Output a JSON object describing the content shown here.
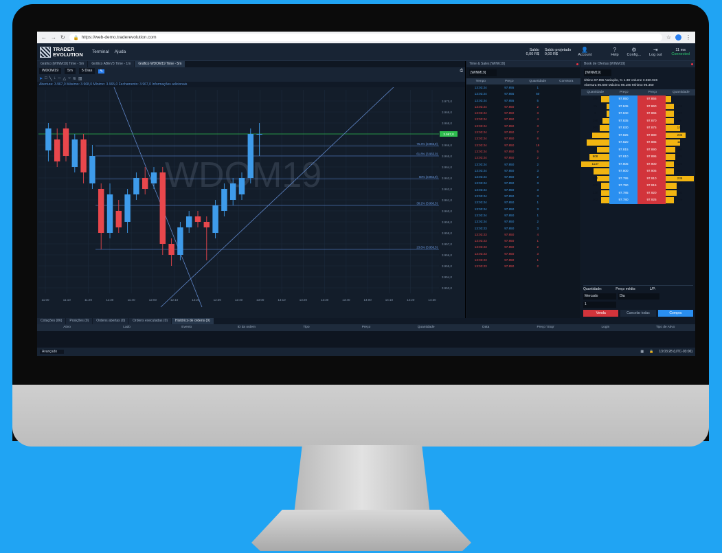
{
  "browser": {
    "url": "https://web-demo.traderevolution.com"
  },
  "app": {
    "logo_line1": "TRADER",
    "logo_line2": "EVOLUTION",
    "menu": [
      "Terminal",
      "Ajuda"
    ],
    "saldo_label": "Saldo",
    "saldo_value": "0,00 R$",
    "projetado_label": "Saldo projetado",
    "projetado_value": "0,00 R$",
    "account_label": "Account",
    "help_label": "Help",
    "config_label": "Config...",
    "logout_label": "Log out",
    "latency": "11 ms",
    "connection": "Connected"
  },
  "tabs": [
    "Gráfico [WINM19] Time - 5m",
    "Gráfico ABEV3 Time - 1m",
    "Gráfico WDOM19 Time - 5m"
  ],
  "chart_ctrl": {
    "symbol": "WDOM19",
    "timeframe": "5m",
    "period": "5 Dias"
  },
  "chart_ohlc": "Abertura: 3.967,0  Máximo: 3.968,0  Mínimo: 3.965,0  Fechamento: 3.967,0  Informações adicionais",
  "chart_data": {
    "type": "candlestick",
    "watermark": "WDOM19",
    "x_tick_labels": [
      "11:00",
      "11:10",
      "11:20",
      "11:30",
      "11:40",
      "12:00",
      "12:10",
      "12:20",
      "12:30",
      "12:40",
      "13:00",
      "13:10",
      "13:20",
      "13:30",
      "13:40",
      "14:00",
      "14:10",
      "14:20",
      "14:30"
    ],
    "y_tick_labels": [
      "3.970,0",
      "3.969,0",
      "3.968,0",
      "3.967,0",
      "3.966,0",
      "3.965,0",
      "3.964,0",
      "3.963,0",
      "3.962,0",
      "3.961,0",
      "3.960,0",
      "3.959,0",
      "3.958,0",
      "3.957,0",
      "3.956,0",
      "3.955,0",
      "3.954,0",
      "3.953,0"
    ],
    "ylim": [
      3952.5,
      3971
    ],
    "last_price": "3.967,0",
    "fib_levels": [
      {
        "label": "76.4% (3.965,9)",
        "value": 3965.9
      },
      {
        "label": "61.8% (3.965,0)",
        "value": 3965.0
      },
      {
        "label": "50% (3.962,9)",
        "value": 3962.9
      },
      {
        "label": "38.2% (3.960,5)",
        "value": 3960.5
      },
      {
        "label": "23.6% (3.956,5)",
        "value": 3956.5
      }
    ],
    "candles": [
      {
        "o": 3965.5,
        "c": 3967.5,
        "h": 3968.0,
        "l": 3964.5
      },
      {
        "o": 3966.5,
        "c": 3964.5,
        "h": 3967.5,
        "l": 3964.0
      },
      {
        "o": 3967.5,
        "c": 3965.0,
        "h": 3968.0,
        "l": 3964.5
      },
      {
        "o": 3964.0,
        "c": 3966.5,
        "h": 3967.0,
        "l": 3963.5
      },
      {
        "o": 3966.5,
        "c": 3963.5,
        "h": 3967.0,
        "l": 3962.5
      },
      {
        "o": 3962.5,
        "c": 3965.0,
        "h": 3966.0,
        "l": 3962.0
      },
      {
        "o": 3962.0,
        "c": 3958.0,
        "h": 3962.5,
        "l": 3956.5
      },
      {
        "o": 3958.0,
        "c": 3961.5,
        "h": 3962.5,
        "l": 3957.5
      },
      {
        "o": 3960.0,
        "c": 3958.5,
        "h": 3961.0,
        "l": 3958.0
      },
      {
        "o": 3959.0,
        "c": 3961.5,
        "h": 3962.0,
        "l": 3958.0
      },
      {
        "o": 3961.5,
        "c": 3963.0,
        "h": 3963.5,
        "l": 3961.0
      },
      {
        "o": 3963.0,
        "c": 3962.0,
        "h": 3964.0,
        "l": 3961.5
      },
      {
        "o": 3962.5,
        "c": 3963.5,
        "h": 3964.0,
        "l": 3962.0
      },
      {
        "o": 3963.5,
        "c": 3957.0,
        "h": 3964.0,
        "l": 3956.0
      },
      {
        "o": 3957.0,
        "c": 3956.0,
        "h": 3957.5,
        "l": 3955.0
      },
      {
        "o": 3956.0,
        "c": 3958.5,
        "h": 3959.0,
        "l": 3955.5
      },
      {
        "o": 3958.5,
        "c": 3959.5,
        "h": 3960.0,
        "l": 3958.0
      },
      {
        "o": 3959.5,
        "c": 3959.0,
        "h": 3960.0,
        "l": 3958.5
      },
      {
        "o": 3959.0,
        "c": 3958.5,
        "h": 3959.5,
        "l": 3955.5
      },
      {
        "o": 3958.0,
        "c": 3960.5,
        "h": 3961.0,
        "l": 3957.5
      },
      {
        "o": 3960.0,
        "c": 3962.0,
        "h": 3962.5,
        "l": 3959.5
      },
      {
        "o": 3961.0,
        "c": 3962.5,
        "h": 3963.0,
        "l": 3960.5
      },
      {
        "o": 3961.5,
        "c": 3963.0,
        "h": 3963.5,
        "l": 3961.0
      },
      {
        "o": 3963.0,
        "c": 3967.0,
        "h": 3967.5,
        "l": 3962.5
      },
      {
        "o": 3967.0,
        "c": 3967.0,
        "h": 3968.0,
        "l": 3965.0
      }
    ]
  },
  "time_sales": {
    "title": "Time & Sales [WIN619]",
    "symbol": "[WINM19]",
    "headers": [
      "Tempo",
      "Preço",
      "Quantidade",
      "Corretora"
    ],
    "rows": [
      {
        "t": "13:03:24",
        "p": "97.855",
        "q": "1",
        "side": "buy"
      },
      {
        "t": "13:03:24",
        "p": "97.855",
        "q": "50",
        "side": "buy"
      },
      {
        "t": "13:03:24",
        "p": "97.855",
        "q": "5",
        "side": "buy"
      },
      {
        "t": "13:03:24",
        "p": "97.850",
        "q": "2",
        "side": "sell"
      },
      {
        "t": "13:03:24",
        "p": "97.850",
        "q": "3",
        "side": "sell"
      },
      {
        "t": "13:03:24",
        "p": "97.850",
        "q": "4",
        "side": "sell"
      },
      {
        "t": "13:03:24",
        "p": "97.850",
        "q": "3",
        "side": "sell"
      },
      {
        "t": "13:03:24",
        "p": "97.850",
        "q": "7",
        "side": "sell"
      },
      {
        "t": "13:03:24",
        "p": "97.850",
        "q": "8",
        "side": "sell"
      },
      {
        "t": "13:03:24",
        "p": "97.850",
        "q": "19",
        "side": "sell"
      },
      {
        "t": "13:03:24",
        "p": "97.850",
        "q": "5",
        "side": "sell"
      },
      {
        "t": "13:03:24",
        "p": "97.850",
        "q": "2",
        "side": "sell"
      },
      {
        "t": "13:03:24",
        "p": "97.850",
        "q": "2",
        "side": "buy"
      },
      {
        "t": "13:03:24",
        "p": "97.850",
        "q": "3",
        "side": "buy"
      },
      {
        "t": "13:03:24",
        "p": "97.850",
        "q": "2",
        "side": "buy"
      },
      {
        "t": "13:03:24",
        "p": "97.850",
        "q": "3",
        "side": "buy"
      },
      {
        "t": "13:03:24",
        "p": "97.850",
        "q": "3",
        "side": "buy"
      },
      {
        "t": "13:03:24",
        "p": "97.850",
        "q": "3",
        "side": "buy"
      },
      {
        "t": "13:03:24",
        "p": "97.850",
        "q": "1",
        "side": "buy"
      },
      {
        "t": "13:03:24",
        "p": "97.850",
        "q": "3",
        "side": "buy"
      },
      {
        "t": "13:03:24",
        "p": "97.850",
        "q": "1",
        "side": "buy"
      },
      {
        "t": "13:03:24",
        "p": "97.850",
        "q": "2",
        "side": "buy"
      },
      {
        "t": "13:03:23",
        "p": "97.850",
        "q": "3",
        "side": "buy"
      },
      {
        "t": "13:03:23",
        "p": "97.850",
        "q": "4",
        "side": "sell"
      },
      {
        "t": "13:03:23",
        "p": "97.850",
        "q": "1",
        "side": "sell"
      },
      {
        "t": "13:03:23",
        "p": "97.850",
        "q": "2",
        "side": "sell"
      },
      {
        "t": "13:03:23",
        "p": "97.850",
        "q": "3",
        "side": "sell"
      },
      {
        "t": "13:03:23",
        "p": "97.850",
        "q": "1",
        "side": "sell"
      },
      {
        "t": "13:03:23",
        "p": "97.850",
        "q": "2",
        "side": "sell"
      }
    ]
  },
  "book": {
    "title": "Book de Ofertas [WINM19]",
    "symbol": "[WINM19]",
    "line1": "Último  97.855 Variação, % 1.38  Volume 3.650.926",
    "line2": "Abertura 96.680 Máximo  98.180 Mínimo 96.360",
    "headers": [
      "Quantidade",
      "Preço",
      "Preço",
      "Quantidade"
    ],
    "bids": [
      {
        "q": "188",
        "p": "97.850",
        "f": 0.3
      },
      {
        "q": "25",
        "p": "97.845",
        "f": 0.1
      },
      {
        "q": "6",
        "p": "97.840",
        "f": 0.1
      },
      {
        "q": "156",
        "p": "97.835",
        "f": 0.25
      },
      {
        "q": "260",
        "p": "97.830",
        "f": 0.35
      },
      {
        "q": "",
        "p": "97.825",
        "f": 0.6
      },
      {
        "q": "",
        "p": "97.820",
        "f": 0.8
      },
      {
        "q": "67",
        "p": "97.815",
        "f": 0.45
      },
      {
        "q": "908",
        "p": "97.810",
        "f": 0.7
      },
      {
        "q": "1137",
        "p": "97.805",
        "f": 1.0
      },
      {
        "q": "",
        "p": "97.800",
        "f": 0.55
      },
      {
        "q": "212",
        "p": "97.795",
        "f": 0.45
      },
      {
        "q": "206",
        "p": "97.790",
        "f": 0.3
      },
      {
        "q": "226",
        "p": "97.785",
        "f": 0.3
      },
      {
        "q": "202",
        "p": "97.780",
        "f": 0.3
      }
    ],
    "asks": [
      {
        "p": "97.855",
        "q": "",
        "f": 0.2
      },
      {
        "p": "97.860",
        "q": "106",
        "f": 0.3
      },
      {
        "p": "97.865",
        "q": "222",
        "f": 0.3
      },
      {
        "p": "97.870",
        "q": "98",
        "f": 0.3
      },
      {
        "p": "97.875",
        "q": "173",
        "f": 0.5
      },
      {
        "p": "97.880",
        "q": "232",
        "f": 0.7
      },
      {
        "p": "97.885",
        "q": "117",
        "f": 0.5
      },
      {
        "p": "97.890",
        "q": "192",
        "f": 0.35
      },
      {
        "p": "97.895",
        "q": "181",
        "f": 0.35
      },
      {
        "p": "97.900",
        "q": "186",
        "f": 0.3
      },
      {
        "p": "97.905",
        "q": "208",
        "f": 0.3
      },
      {
        "p": "97.910",
        "q": "235",
        "f": 1.0
      },
      {
        "p": "97.915",
        "q": "262",
        "f": 0.4
      },
      {
        "p": "97.920",
        "q": "191",
        "f": 0.4
      },
      {
        "p": "97.925",
        "q": "249",
        "f": 0.3
      }
    ],
    "qty_label": "Quantidade:",
    "avg_label": "Preço médio:",
    "pl_label": "L/P:",
    "order_type": "Mercado",
    "validity": "Dia",
    "qty_value": "1",
    "sell_label": "Venda",
    "cancel_label": "Cancelar todas",
    "buy_label": "Compra"
  },
  "bottom": {
    "tabs": [
      "Cotações (86)",
      "Posições (0)",
      "Ordens abertas (0)",
      "Ordens executadas (0)",
      "Histórico de ordens (0)"
    ],
    "columns": [
      "Ativo",
      "Lado",
      "Evento",
      "ID da ordem",
      "Tipo",
      "Preço",
      "Quantidade",
      "Data",
      "Preço 'Stop'",
      "Login",
      "Tipo de Ativo"
    ],
    "status_left": "Avançado",
    "clock": "13:03:28 (UTC-03:00)"
  }
}
